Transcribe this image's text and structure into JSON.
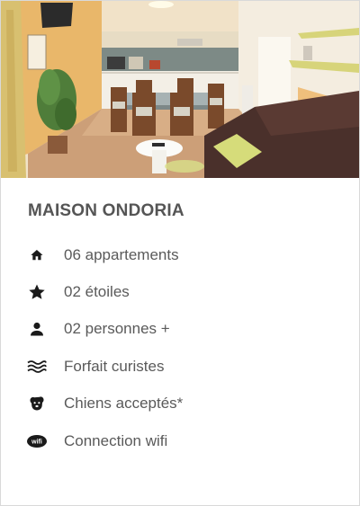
{
  "card": {
    "title": "MAISON ONDORIA",
    "image_alt": "Intérieur d'un appartement avec cuisine, table et canapé",
    "features": [
      {
        "icon": "home-icon",
        "label": "06 appartements"
      },
      {
        "icon": "star-icon",
        "label": "02 étoiles"
      },
      {
        "icon": "person-icon",
        "label": "02 personnes +"
      },
      {
        "icon": "waves-icon",
        "label": "Forfait curistes"
      },
      {
        "icon": "dog-icon",
        "label": "Chiens acceptés*"
      },
      {
        "icon": "wifi-icon",
        "label": "Connection wifi"
      }
    ]
  },
  "colors": {
    "text": "#5a5a5a",
    "icon": "#1a1a1a",
    "border": "#d9d9d9"
  }
}
